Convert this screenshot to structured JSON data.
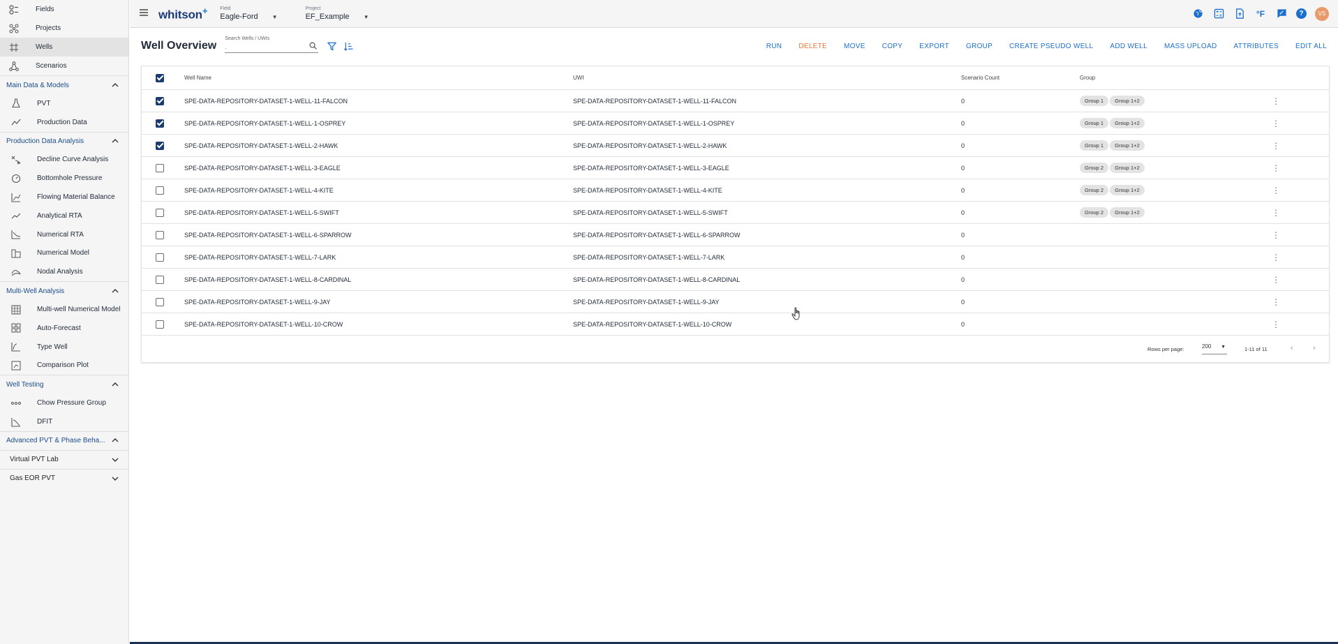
{
  "sidebar": {
    "top_items": [
      {
        "label": "Fields",
        "icon": "fields-icon"
      },
      {
        "label": "Projects",
        "icon": "projects-icon"
      },
      {
        "label": "Wells",
        "icon": "wells-icon"
      },
      {
        "label": "Scenarios",
        "icon": "scenarios-icon"
      }
    ],
    "sections": {
      "main_data": {
        "label": "Main Data & Models",
        "items": [
          "PVT",
          "Production Data"
        ]
      },
      "pda": {
        "label": "Production Data Analysis",
        "items": [
          "Decline Curve Analysis",
          "Bottomhole Pressure",
          "Flowing Material Balance",
          "Analytical RTA",
          "Numerical RTA",
          "Numerical Model",
          "Nodal Analysis"
        ]
      },
      "mwa": {
        "label": "Multi-Well Analysis",
        "items": [
          "Multi-well Numerical Model",
          "Auto-Forecast",
          "Type Well",
          "Comparison Plot"
        ]
      },
      "wt": {
        "label": "Well Testing",
        "items": [
          "Chow Pressure Group",
          "DFIT"
        ]
      },
      "adv": {
        "label": "Advanced PVT & Phase Beha...",
        "subs": [
          "Virtual PVT Lab",
          "Gas EOR PVT"
        ]
      }
    }
  },
  "topbar": {
    "logo": "whitson",
    "logo_plus": "+",
    "field_caption": "Field",
    "field_value": "Eagle-Ford",
    "project_caption": "Project",
    "project_value": "EF_Example",
    "temp_unit": "°F",
    "help": "?",
    "avatar": "VS"
  },
  "page": {
    "title": "Well Overview",
    "search_caption": "Search Wells / UWIs",
    "search_value": "-",
    "actions": [
      "RUN",
      "DELETE",
      "MOVE",
      "COPY",
      "EXPORT",
      "GROUP",
      "CREATE PSEUDO WELL",
      "ADD WELL",
      "MASS UPLOAD",
      "ATTRIBUTES",
      "EDIT ALL"
    ]
  },
  "table": {
    "headers": {
      "name": "Well Name",
      "uwi": "UWI",
      "scenario_count": "Scenario Count",
      "group": "Group"
    },
    "rows": [
      {
        "checked": true,
        "name": "SPE-DATA-REPOSITORY-DATASET-1-WELL-11-FALCON",
        "uwi": "SPE-DATA-REPOSITORY-DATASET-1-WELL-11-FALCON",
        "sc": "0",
        "groups": [
          "Group 1",
          "Group 1+2"
        ]
      },
      {
        "checked": true,
        "name": "SPE-DATA-REPOSITORY-DATASET-1-WELL-1-OSPREY",
        "uwi": "SPE-DATA-REPOSITORY-DATASET-1-WELL-1-OSPREY",
        "sc": "0",
        "groups": [
          "Group 1",
          "Group 1+2"
        ]
      },
      {
        "checked": true,
        "name": "SPE-DATA-REPOSITORY-DATASET-1-WELL-2-HAWK",
        "uwi": "SPE-DATA-REPOSITORY-DATASET-1-WELL-2-HAWK",
        "sc": "0",
        "groups": [
          "Group 1",
          "Group 1+2"
        ]
      },
      {
        "checked": false,
        "name": "SPE-DATA-REPOSITORY-DATASET-1-WELL-3-EAGLE",
        "uwi": "SPE-DATA-REPOSITORY-DATASET-1-WELL-3-EAGLE",
        "sc": "0",
        "groups": [
          "Group 2",
          "Group 1+2"
        ]
      },
      {
        "checked": false,
        "name": "SPE-DATA-REPOSITORY-DATASET-1-WELL-4-KITE",
        "uwi": "SPE-DATA-REPOSITORY-DATASET-1-WELL-4-KITE",
        "sc": "0",
        "groups": [
          "Group 2",
          "Group 1+2"
        ]
      },
      {
        "checked": false,
        "name": "SPE-DATA-REPOSITORY-DATASET-1-WELL-5-SWIFT",
        "uwi": "SPE-DATA-REPOSITORY-DATASET-1-WELL-5-SWIFT",
        "sc": "0",
        "groups": [
          "Group 2",
          "Group 1+2"
        ]
      },
      {
        "checked": false,
        "name": "SPE-DATA-REPOSITORY-DATASET-1-WELL-6-SPARROW",
        "uwi": "SPE-DATA-REPOSITORY-DATASET-1-WELL-6-SPARROW",
        "sc": "0",
        "groups": []
      },
      {
        "checked": false,
        "name": "SPE-DATA-REPOSITORY-DATASET-1-WELL-7-LARK",
        "uwi": "SPE-DATA-REPOSITORY-DATASET-1-WELL-7-LARK",
        "sc": "0",
        "groups": []
      },
      {
        "checked": false,
        "name": "SPE-DATA-REPOSITORY-DATASET-1-WELL-8-CARDINAL",
        "uwi": "SPE-DATA-REPOSITORY-DATASET-1-WELL-8-CARDINAL",
        "sc": "0",
        "groups": []
      },
      {
        "checked": false,
        "name": "SPE-DATA-REPOSITORY-DATASET-1-WELL-9-JAY",
        "uwi": "SPE-DATA-REPOSITORY-DATASET-1-WELL-9-JAY",
        "sc": "0",
        "groups": []
      },
      {
        "checked": false,
        "name": "SPE-DATA-REPOSITORY-DATASET-1-WELL-10-CROW",
        "uwi": "SPE-DATA-REPOSITORY-DATASET-1-WELL-10-CROW",
        "sc": "0",
        "groups": []
      }
    ],
    "footer": {
      "rows_per_page_label": "Rows per page:",
      "rows_per_page": "200",
      "range": "1-11 of 11"
    }
  },
  "colors": {
    "accent": "#1b6fcf",
    "danger": "#e0783c",
    "nav_section": "#1a4c8c",
    "checkbox_on": "#1a3c6e"
  }
}
